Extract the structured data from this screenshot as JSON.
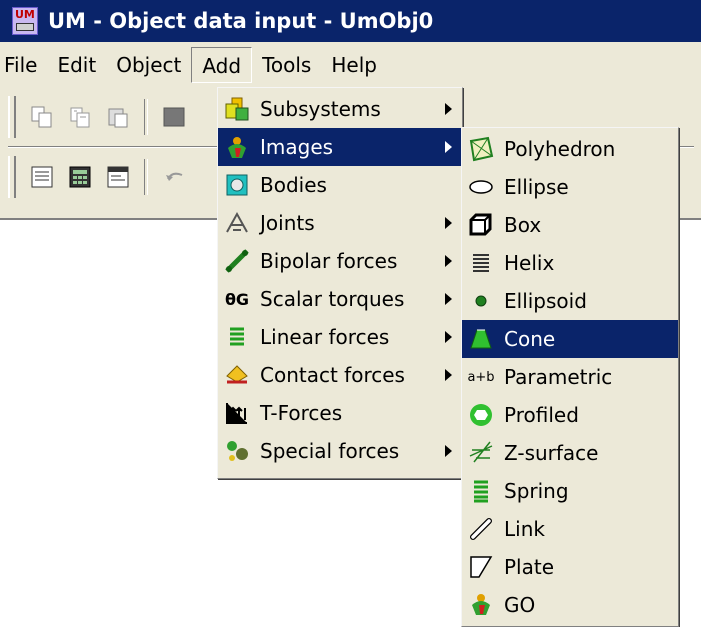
{
  "window": {
    "title": "UM - Object data input - UmObj0",
    "icon_text": "UM"
  },
  "menubar": {
    "items": [
      {
        "label": "File"
      },
      {
        "label": "Edit"
      },
      {
        "label": "Object"
      },
      {
        "label": "Add"
      },
      {
        "label": "Tools"
      },
      {
        "label": "Help"
      }
    ]
  },
  "add_menu": {
    "items": [
      {
        "label": "Subsystems",
        "icon": "subsystems-icon",
        "submenu": true
      },
      {
        "label": "Images",
        "icon": "images-icon",
        "submenu": true,
        "selected": true
      },
      {
        "label": "Bodies",
        "icon": "bodies-icon",
        "submenu": false
      },
      {
        "label": "Joints",
        "icon": "joints-icon",
        "submenu": true
      },
      {
        "label": "Bipolar forces",
        "icon": "bipolar-forces-icon",
        "submenu": true
      },
      {
        "label": "Scalar torques",
        "icon": "scalar-torques-icon",
        "submenu": true
      },
      {
        "label": "Linear forces",
        "icon": "linear-forces-icon",
        "submenu": true
      },
      {
        "label": "Contact forces",
        "icon": "contact-forces-icon",
        "submenu": true
      },
      {
        "label": "T-Forces",
        "icon": "t-forces-icon",
        "submenu": false
      },
      {
        "label": "Special forces",
        "icon": "special-forces-icon",
        "submenu": true
      }
    ]
  },
  "images_menu": {
    "items": [
      {
        "label": "Polyhedron",
        "icon": "polyhedron-icon"
      },
      {
        "label": "Ellipse",
        "icon": "ellipse-icon"
      },
      {
        "label": "Box",
        "icon": "box-icon"
      },
      {
        "label": "Helix",
        "icon": "helix-icon"
      },
      {
        "label": "Ellipsoid",
        "icon": "ellipsoid-icon"
      },
      {
        "label": "Cone",
        "icon": "cone-icon",
        "selected": true
      },
      {
        "label": "Parametric",
        "icon": "parametric-icon"
      },
      {
        "label": "Profiled",
        "icon": "profiled-icon"
      },
      {
        "label": "Z-surface",
        "icon": "z-surface-icon"
      },
      {
        "label": "Spring",
        "icon": "spring-icon"
      },
      {
        "label": "Link",
        "icon": "link-icon"
      },
      {
        "label": "Plate",
        "icon": "plate-icon"
      },
      {
        "label": "GO",
        "icon": "go-icon"
      }
    ]
  },
  "icon_text": {
    "scalar_torques": "θG",
    "parametric": "a+b"
  },
  "colors": {
    "titlebar": "#0a246a",
    "selection": "#0a246a",
    "face": "#ece9d8"
  }
}
